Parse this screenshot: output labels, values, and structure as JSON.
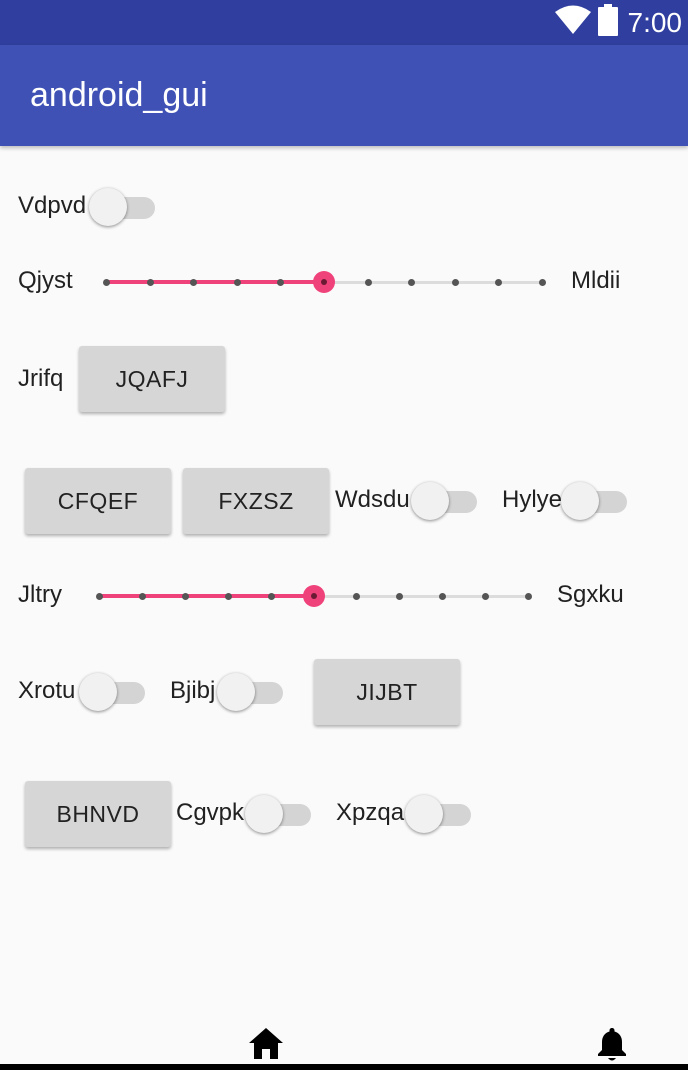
{
  "status_bar": {
    "time": "7:00",
    "icons": [
      "wifi-icon",
      "battery-icon"
    ]
  },
  "app_bar": {
    "title": "android_gui"
  },
  "rows": {
    "vdpvd_switch": {
      "label": "Vdpvd",
      "checked": false
    },
    "qjyst_slider": {
      "left_label": "Qjyst",
      "right_label": "Mldii",
      "value": 5,
      "max": 10
    },
    "jrifq": {
      "label": "Jrifq",
      "button": "JQAFJ"
    },
    "row4": {
      "button_1": "CFQEF",
      "button_2": "FXZSZ",
      "switch_1": {
        "label": "Wdsdu",
        "checked": false
      },
      "switch_2": {
        "label": "Hylye",
        "checked": false
      }
    },
    "jltry_slider": {
      "left_label": "Jltry",
      "right_label": "Sgxku",
      "value": 5,
      "max": 10
    },
    "row6": {
      "switch_1": {
        "label": "Xrotu",
        "checked": false
      },
      "switch_2": {
        "label": "Bjibj",
        "checked": false
      },
      "button": "JIJBT"
    },
    "row7": {
      "button": "BHNVD",
      "switch_1": {
        "label": "Cgvpk",
        "checked": false
      },
      "switch_2": {
        "label": "Xpzqa",
        "checked": false
      }
    }
  },
  "bottom_nav": {
    "icons": [
      "home-icon",
      "bell-icon"
    ]
  },
  "colors": {
    "status_bar": "#303f9f",
    "app_bar": "#3f51b5",
    "accent": "#f0427a",
    "background": "#fafafa"
  }
}
